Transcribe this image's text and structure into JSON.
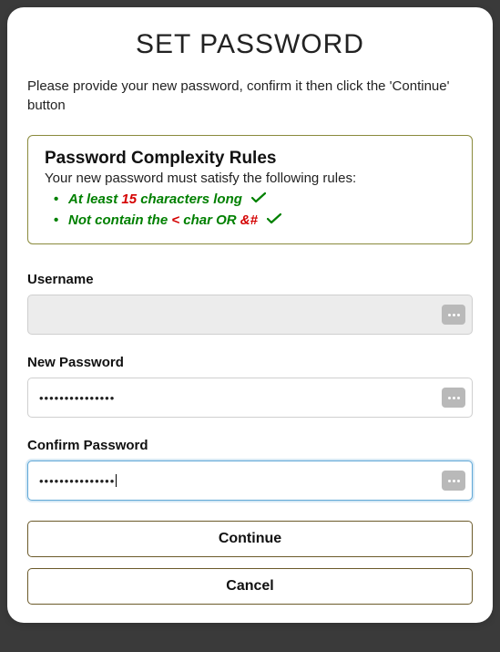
{
  "title": "SET PASSWORD",
  "instruction": "Please provide your new password, confirm it then click the 'Continue' button",
  "rules": {
    "heading": "Password Complexity Rules",
    "subheading": "Your new password must satisfy the following rules:",
    "rule1_prefix": "At least ",
    "rule1_num": "15",
    "rule1_suffix": " characters long",
    "rule2_prefix": "Not contain the ",
    "rule2_char1": "<",
    "rule2_mid": " char OR ",
    "rule2_char2": "&#"
  },
  "fields": {
    "username_label": "Username",
    "username_value": "",
    "newpw_label": "New Password",
    "newpw_masked": "•••••••••••••••",
    "confirmpw_label": "Confirm Password",
    "confirmpw_masked": "•••••••••••••••"
  },
  "buttons": {
    "continue": "Continue",
    "cancel": "Cancel"
  }
}
